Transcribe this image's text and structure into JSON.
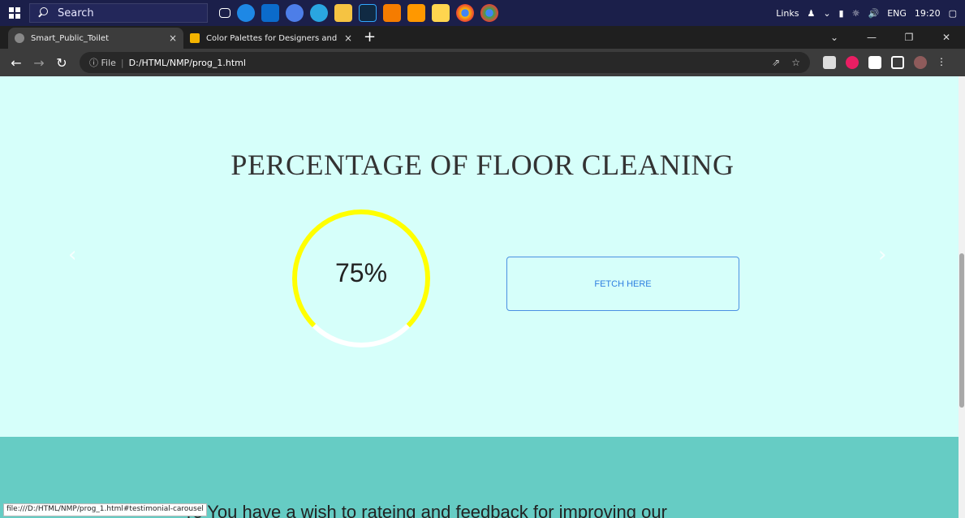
{
  "taskbar": {
    "search_label": "Search",
    "tray_links": "Links",
    "tray_lang": "ENG",
    "tray_time": "19:20"
  },
  "tabs": [
    {
      "title": "Smart_Public_Toilet",
      "close": "×"
    },
    {
      "title": "Color Palettes for Designers and",
      "close": "×"
    }
  ],
  "new_tab": "+",
  "window_controls": {
    "minimize": "—",
    "restore": "❐",
    "close": "✕"
  },
  "address": {
    "scheme_label": "File",
    "url": "D:/HTML/NMP/prog_1.html"
  },
  "page": {
    "heading": "PERCENTAGE OF FLOOR CLEANING",
    "gauge_value": 75,
    "gauge_label": "75%",
    "gauge_color": "#ffff00",
    "gauge_track_color": "#ffffff",
    "fetch_button": "FETCH HERE",
    "prev_arrow": "‹",
    "next_arrow": "›",
    "feedback_text": "re You have a wish to rateing and feedback for improving our"
  },
  "status_url": "file:///D:/HTML/NMP/prog_1.html#testimonial-carousel",
  "colors": {
    "page_bg": "#d6fffa",
    "section_bg": "#66ccc4",
    "button_border": "#4a90e2"
  }
}
